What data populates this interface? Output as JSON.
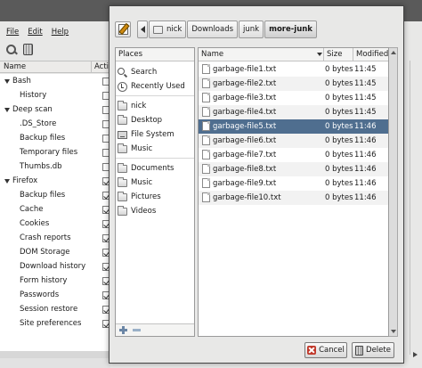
{
  "background_app": {
    "menu": [
      "File",
      "Edit",
      "Help"
    ],
    "columns": {
      "name": "Name",
      "active": "Acti"
    },
    "tree": [
      {
        "label": "Bash",
        "level": 0,
        "checked": false
      },
      {
        "label": "History",
        "level": 1,
        "checked": false
      },
      {
        "label": "Deep scan",
        "level": 0,
        "checked": false
      },
      {
        "label": ".DS_Store",
        "level": 1,
        "checked": false
      },
      {
        "label": "Backup files",
        "level": 1,
        "checked": false
      },
      {
        "label": "Temporary files",
        "level": 1,
        "checked": false
      },
      {
        "label": "Thumbs.db",
        "level": 1,
        "checked": false
      },
      {
        "label": "Firefox",
        "level": 0,
        "checked": true
      },
      {
        "label": "Backup files",
        "level": 1,
        "checked": true
      },
      {
        "label": "Cache",
        "level": 1,
        "checked": true
      },
      {
        "label": "Cookies",
        "level": 1,
        "checked": true
      },
      {
        "label": "Crash reports",
        "level": 1,
        "checked": true
      },
      {
        "label": "DOM Storage",
        "level": 1,
        "checked": true
      },
      {
        "label": "Download history",
        "level": 1,
        "checked": true
      },
      {
        "label": "Form history",
        "level": 1,
        "checked": true
      },
      {
        "label": "Passwords",
        "level": 1,
        "checked": true
      },
      {
        "label": "Session restore",
        "level": 1,
        "checked": true
      },
      {
        "label": "Site preferences",
        "level": 1,
        "checked": true
      }
    ]
  },
  "dialog": {
    "path": [
      "nick",
      "Downloads",
      "junk",
      "more-junk"
    ],
    "active_crumb": "more-junk",
    "places_header": "Places",
    "places": [
      {
        "label": "Search",
        "icon": "search-icon"
      },
      {
        "label": "Recently Used",
        "icon": "recent-icon"
      },
      {
        "label": "nick",
        "icon": "folder-icon"
      },
      {
        "label": "Desktop",
        "icon": "folder-icon"
      },
      {
        "label": "File System",
        "icon": "drive-icon"
      },
      {
        "label": "Music",
        "icon": "folder-icon"
      },
      {
        "label": "Documents",
        "icon": "folder-icon"
      },
      {
        "label": "Music",
        "icon": "folder-icon"
      },
      {
        "label": "Pictures",
        "icon": "folder-icon"
      },
      {
        "label": "Videos",
        "icon": "folder-icon"
      }
    ],
    "columns": {
      "name": "Name",
      "size": "Size",
      "modified": "Modified"
    },
    "files": [
      {
        "name": "garbage-file1.txt",
        "size": "0 bytes",
        "modified": "11:45"
      },
      {
        "name": "garbage-file2.txt",
        "size": "0 bytes",
        "modified": "11:45"
      },
      {
        "name": "garbage-file3.txt",
        "size": "0 bytes",
        "modified": "11:45"
      },
      {
        "name": "garbage-file4.txt",
        "size": "0 bytes",
        "modified": "11:45"
      },
      {
        "name": "garbage-file5.txt",
        "size": "0 bytes",
        "modified": "11:46"
      },
      {
        "name": "garbage-file6.txt",
        "size": "0 bytes",
        "modified": "11:46"
      },
      {
        "name": "garbage-file7.txt",
        "size": "0 bytes",
        "modified": "11:46"
      },
      {
        "name": "garbage-file8.txt",
        "size": "0 bytes",
        "modified": "11:46"
      },
      {
        "name": "garbage-file9.txt",
        "size": "0 bytes",
        "modified": "11:46"
      },
      {
        "name": "garbage-file10.txt",
        "size": "0 bytes",
        "modified": "11:46"
      }
    ],
    "selected_file": "garbage-file5.txt",
    "buttons": {
      "cancel": "Cancel",
      "delete": "Delete"
    },
    "colors": {
      "selection": "#4f6e8f",
      "cancel_icon": "#c0392b"
    }
  }
}
